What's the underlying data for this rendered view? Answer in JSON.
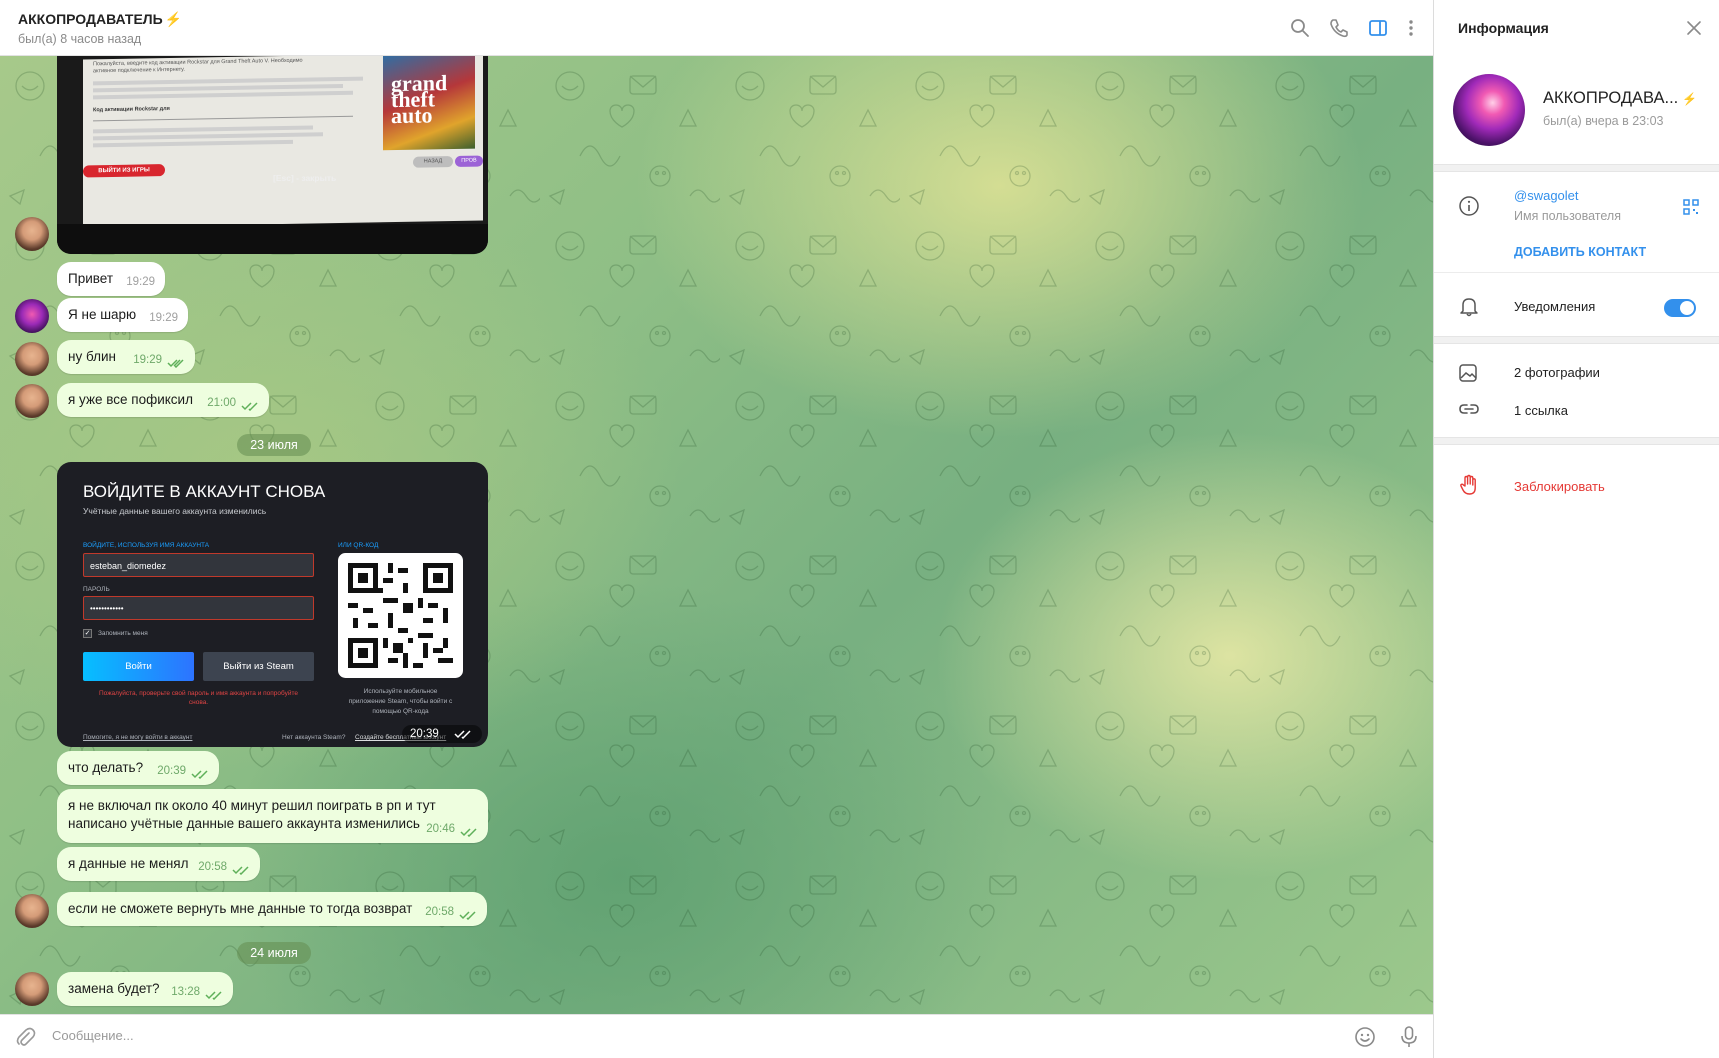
{
  "header": {
    "title": "АККОПРОДАВАТЕЛЬ",
    "title_emoji": "⚡",
    "status": "был(а) 8 часов назад"
  },
  "image1": {
    "text_lines": [
      "Пожалуйста, введите код активации Rockstar для Grand Theft Auto V. Необходимо",
      "активное подключение к Интернету.",
      "Код активации Rockstar для",
      "ВЫЙТИ ИЗ ИГРЫ",
      "[Esc] - закрыть",
      "НАЗАД",
      "ПРОВ"
    ]
  },
  "messages": [
    {
      "text": "Привет",
      "time": "19:29",
      "dir": "in"
    },
    {
      "text": "Я не шарю",
      "time": "19:29",
      "dir": "in"
    },
    {
      "text": "ну блин",
      "time": "19:29",
      "dir": "out"
    },
    {
      "text": "я уже все пофиксил",
      "time": "21:00",
      "dir": "out"
    },
    {
      "text": "что делать?",
      "time": "20:39",
      "dir": "out"
    },
    {
      "text_lines": [
        "я не включал пк около 40 минут решил поиграть в рп и тут",
        "написано учётные данные вашего аккаунта изменились"
      ],
      "time": "20:46",
      "dir": "out"
    },
    {
      "text": "я данные не менял",
      "time": "20:58",
      "dir": "out"
    },
    {
      "text": "если не сможете вернуть мне данные то тогда возврат",
      "time": "20:58",
      "dir": "out"
    },
    {
      "text": "замена будет?",
      "time": "13:28",
      "dir": "out"
    }
  ],
  "dates": [
    "23 июля",
    "24 июля"
  ],
  "steam_image": {
    "title": "ВОЙДИТЕ В АККАУНТ СНОВА",
    "subtitle": "Учётные данные вашего аккаунта изменились",
    "login_label": "ВОЙДИТЕ, ИСПОЛЬЗУЯ ИМЯ АККАУНТА",
    "username": "esteban_diomedez",
    "password_label": "ПАРОЛЬ",
    "password": "••••••••••••",
    "remember": "Запомнить меня",
    "login_button": "Войти",
    "exit_button": "Выйти из Steam",
    "error_lines": [
      "Пожалуйста, проверьте свой пароль и имя аккаунта и попробуйте",
      "снова."
    ],
    "qr_label": "ИЛИ QR-КОД",
    "qr_hint_lines": [
      "Используйте мобильное",
      "приложение Steam, чтобы войти с",
      "помощью QR-кода"
    ],
    "help_link": "Помогите, я не могу войти в аккаунт",
    "no_account": "Нет аккаунта Steam?",
    "create_link": "Создайте бесплатный аккаунт",
    "time": "20:39"
  },
  "composer": {
    "placeholder": "Сообщение..."
  },
  "info": {
    "title": "Информация",
    "name": "АККОПРОДАВА...",
    "name_emoji": "⚡",
    "last_seen": "был(а) вчера в 23:03",
    "username": "@swagolet",
    "username_caption": "Имя пользователя",
    "add_contact": "ДОБАВИТЬ КОНТАКТ",
    "notifications": "Уведомления",
    "notifications_on": true,
    "photos": "2 фотографии",
    "links": "1 ссылка",
    "block": "Заблокировать"
  },
  "colors": {
    "accent": "#3390ec",
    "out_bubble": "#eefedf",
    "in_bubble": "#ffffff",
    "danger": "#e53935",
    "check": "#5fb05a"
  },
  "icons": [
    "search-icon",
    "phone-icon",
    "sidebar-toggle-icon",
    "more-vertical-icon",
    "close-icon",
    "info-icon",
    "qr-icon",
    "bell-icon",
    "photo-icon",
    "link-icon",
    "block-hand-icon",
    "attach-icon",
    "emoji-icon",
    "microphone-icon"
  ]
}
